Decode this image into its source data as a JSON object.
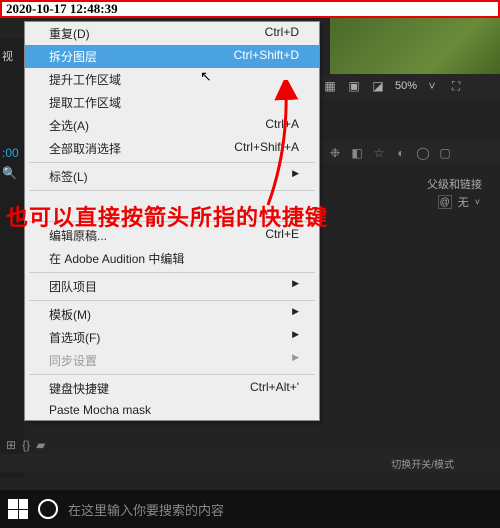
{
  "timestamp": "2020-10-17 12:48:39",
  "left": {
    "tab": "视",
    "timecode": ":00"
  },
  "menu": {
    "items": [
      {
        "label": "重复(D)",
        "shortcut": "Ctrl+D",
        "state": "normal"
      },
      {
        "label": "拆分图层",
        "shortcut": "Ctrl+Shift+D",
        "state": "highlight"
      },
      {
        "label": "提升工作区域",
        "shortcut": "",
        "state": "normal"
      },
      {
        "label": "提取工作区域",
        "shortcut": "",
        "state": "normal"
      },
      {
        "label": "全选(A)",
        "shortcut": "Ctrl+A",
        "state": "normal"
      },
      {
        "label": "全部取消选择",
        "shortcut": "Ctrl+Shift+A",
        "state": "normal"
      },
      {
        "sep": true
      },
      {
        "label": "标签(L)",
        "shortcut": "",
        "state": "normal",
        "submenu": true
      },
      {
        "sep": true
      },
      {
        "gap": true
      },
      {
        "sep": true
      },
      {
        "label": "编辑原稿...",
        "shortcut": "Ctrl+E",
        "state": "normal"
      },
      {
        "label": "在 Adobe Audition 中编辑",
        "shortcut": "",
        "state": "normal"
      },
      {
        "sep": true
      },
      {
        "label": "团队项目",
        "shortcut": "",
        "state": "normal",
        "submenu": true
      },
      {
        "sep": true
      },
      {
        "label": "模板(M)",
        "shortcut": "",
        "state": "normal",
        "submenu": true
      },
      {
        "label": "首选项(F)",
        "shortcut": "",
        "state": "normal",
        "submenu": true
      },
      {
        "label": "同步设置",
        "shortcut": "",
        "state": "disabled",
        "submenu": true
      },
      {
        "sep": true
      },
      {
        "label": "键盘快捷键",
        "shortcut": "Ctrl+Alt+'",
        "state": "normal"
      },
      {
        "label": "Paste Mocha mask",
        "shortcut": "",
        "state": "normal"
      }
    ]
  },
  "annotation": "也可以直接按箭头所指的快捷键",
  "toolbar": {
    "zoom": "50%"
  },
  "timeline": {
    "parent_header": "父级和链接",
    "none": "无",
    "footer": "切换开关/模式"
  },
  "taskbar": {
    "search_placeholder": "在这里输入你要搜索的内容"
  }
}
